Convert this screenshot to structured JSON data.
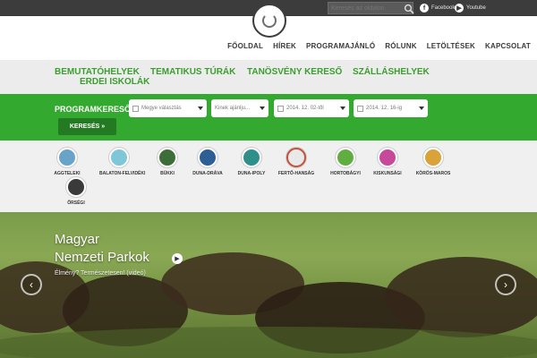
{
  "topbar": {
    "search_placeholder": "Keresés az oldalon",
    "social": [
      {
        "label": "Facebook",
        "icon": "facebook-icon"
      },
      {
        "label": "Youtube",
        "icon": "youtube-icon"
      }
    ]
  },
  "mainnav": [
    "FŐOLDAL",
    "HÍREK",
    "PROGRAMAJÁNLÓ",
    "RÓLUNK",
    "LETÖLTÉSEK",
    "KAPCSOLAT"
  ],
  "categories": [
    "BEMUTATÓHELYEK",
    "TEMATIKUS TÚRÁK",
    "TANÖSVÉNY KERESŐ",
    "SZÁLLÁSHELYEK",
    "ERDEI ISKOLÁK"
  ],
  "program": {
    "label": "PROGRAMKERESŐ",
    "county": "Megye választás",
    "audience": "Kinek ajánlju...",
    "date_from": "2014. 12. 02-től",
    "date_to": "2014. 12. 16-ig",
    "search_button": "KERESÉS »"
  },
  "parks": [
    "AGGTELEKI",
    "BALATON-FELVIDÉKI",
    "BÜKKI",
    "DUNA-DRÁVA",
    "DUNA-IPOLY",
    "FERTŐ-HANSÁG",
    "HORTOBÁGYI",
    "KISKUNSÁGI",
    "KÖRÖS-MAROS",
    "ŐRSÉGI"
  ],
  "hero": {
    "title_line1": "Magyar",
    "title_line2": "Nemzeti Parkok",
    "subtitle": "Élmény? Természetesen! (videó)"
  },
  "colors": {
    "topbar": "#3c3c3c",
    "green": "#34a930",
    "category_text": "#3a9f2e",
    "button": "#247a22"
  }
}
